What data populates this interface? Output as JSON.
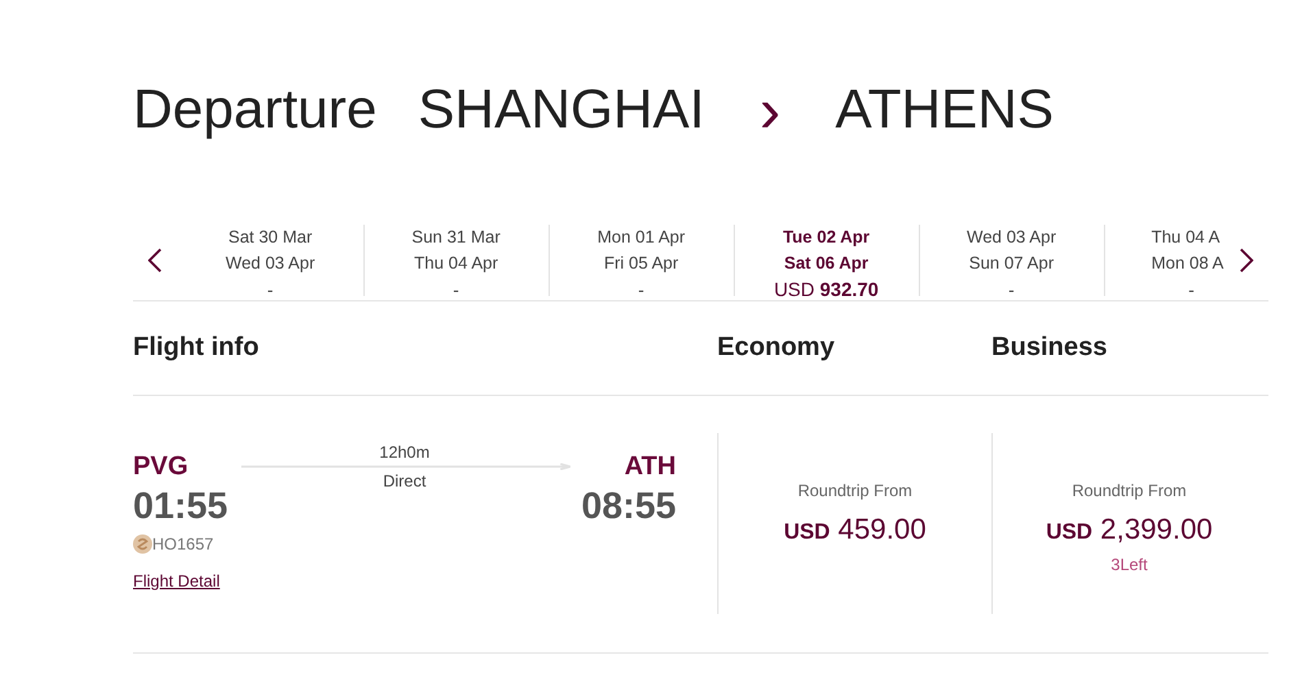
{
  "heading": {
    "label": "Departure",
    "origin": "SHANGHAI",
    "separator": "›",
    "destination": "ATHENS"
  },
  "date_strip": [
    {
      "outbound": "Sat 30 Mar",
      "return": "Wed 03 Apr",
      "price": "-",
      "selected": false
    },
    {
      "outbound": "Sun 31 Mar",
      "return": "Thu 04 Apr",
      "price": "-",
      "selected": false
    },
    {
      "outbound": "Mon 01 Apr",
      "return": "Fri 05 Apr",
      "price": "-",
      "selected": false
    },
    {
      "outbound": "Tue 02 Apr",
      "return": "Sat 06 Apr",
      "price": "USD **932.70**",
      "selected": true
    },
    {
      "outbound": "Wed 03 Apr",
      "return": "Sun 07 Apr",
      "price": "-",
      "selected": false
    },
    {
      "outbound": "Thu 04 A",
      "return": "Mon 08 A",
      "price": "-",
      "selected": false
    }
  ],
  "columns": [
    "Flight info",
    "Economy",
    "Business"
  ],
  "flight": {
    "origin": "PVG",
    "departure_time": "01:55",
    "duration": "12h0m",
    "stops": "Direct",
    "destination": "ATH",
    "arrival_time": "08:55",
    "flight_number": "HO1657",
    "detail_link": "Flight Detail"
  },
  "fares": [
    {
      "caption": "Roundtrip From",
      "currency": "USD",
      "amount": "459.00"
    },
    {
      "caption": "Roundtrip From",
      "currency": "USD",
      "amount": "2,399.00",
      "seats_left": "3Left"
    }
  ]
}
